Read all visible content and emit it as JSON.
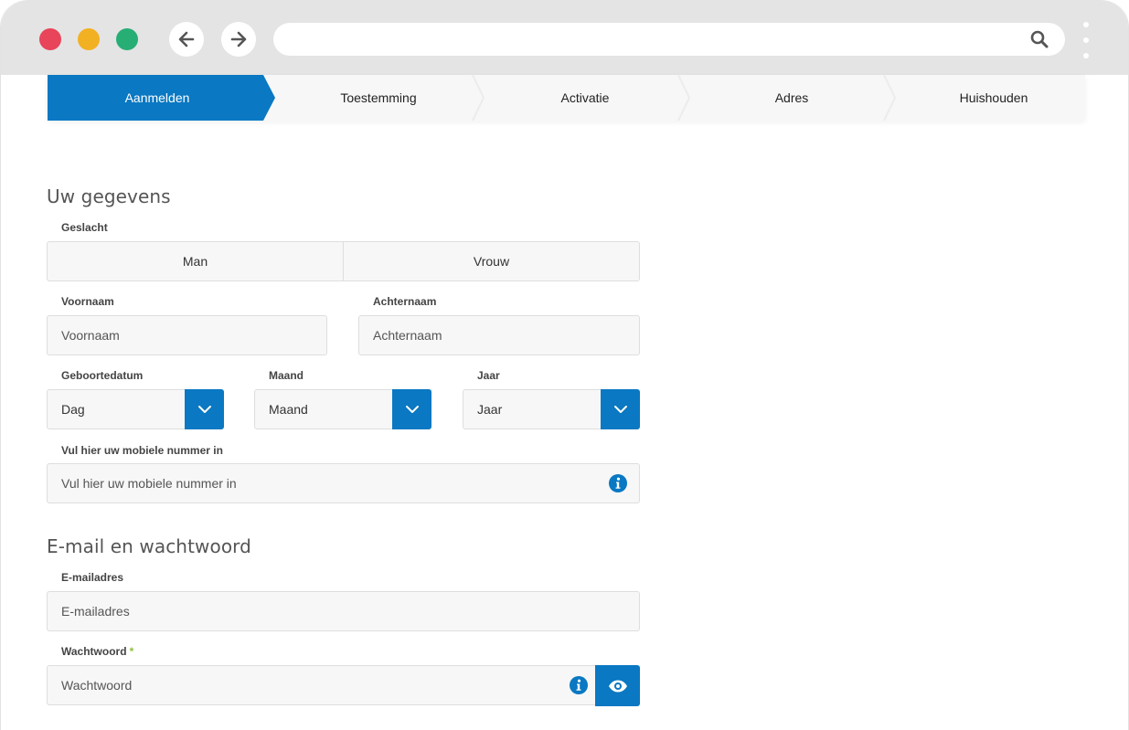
{
  "browser": {
    "controls": [
      "close-dot",
      "minimize-dot",
      "maximize-dot"
    ],
    "colors": {
      "close": "#e8445a",
      "minimize": "#f2b023",
      "maximize": "#27ae74"
    },
    "address": ""
  },
  "stepper": {
    "steps": [
      {
        "label": "Aanmelden",
        "active": true
      },
      {
        "label": "Toestemming",
        "active": false
      },
      {
        "label": "Activatie",
        "active": false
      },
      {
        "label": "Adres",
        "active": false
      },
      {
        "label": "Huishouden",
        "active": false
      }
    ],
    "accent": "#0a78c2"
  },
  "personal": {
    "title": "Uw gegevens",
    "gender": {
      "label": "Geslacht",
      "options": [
        "Man",
        "Vrouw"
      ]
    },
    "firstname": {
      "label": "Voornaam",
      "placeholder": "Voornaam"
    },
    "lastname": {
      "label": "Achternaam",
      "placeholder": "Achternaam"
    },
    "birthdate": {
      "label_day": "Geboortedatum",
      "day": "Dag",
      "label_month": "Maand",
      "month": "Maand",
      "label_year": "Jaar",
      "year": "Jaar"
    },
    "mobile": {
      "label": "Vul hier uw mobiele nummer in",
      "placeholder": "Vul hier uw mobiele nummer in"
    }
  },
  "account": {
    "title": "E-mail en wachtwoord",
    "email": {
      "label": "E-mailadres",
      "placeholder": "E-mailadres"
    },
    "password": {
      "label": "Wachtwoord",
      "required_mark": "*",
      "placeholder": "Wachtwoord"
    }
  }
}
